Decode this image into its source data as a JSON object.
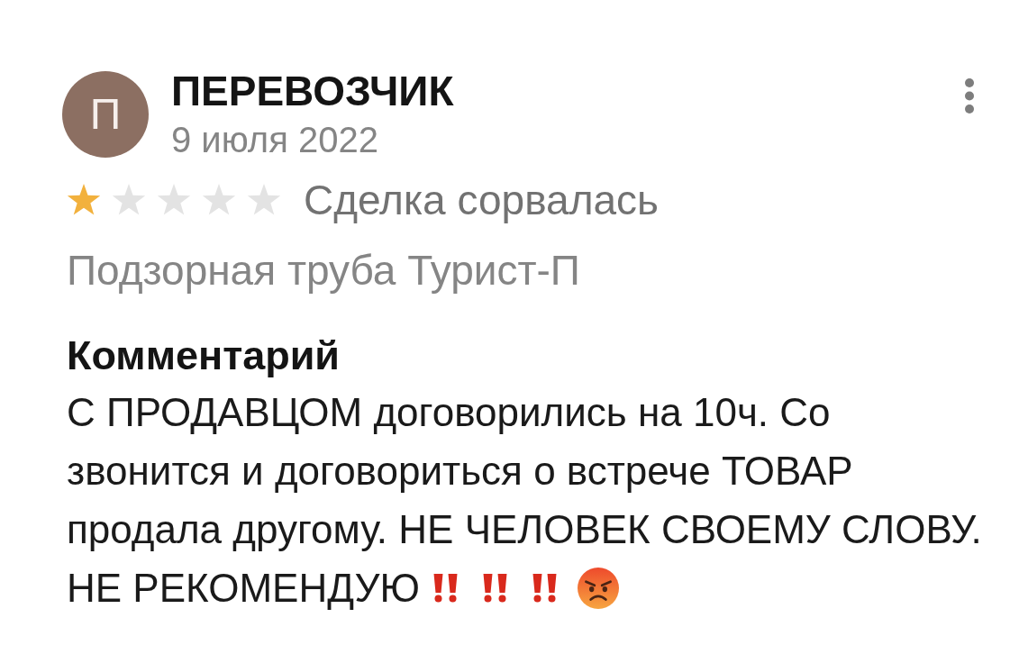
{
  "review": {
    "author": {
      "initial": "П",
      "name": "ПЕРЕВОЗЧИК"
    },
    "date": "9 июля 2022",
    "stars": 1,
    "outcome": "Сделка сорвалась",
    "item": "Подзорная труба Турист-П",
    "comment": {
      "heading": "Комментарий",
      "text": "С ПРОДАВЦОМ договорились на 10ч. Со звонится и договориться о встрече ТОВАР продала другому. НЕ ЧЕЛОВЕК СВОЕМУ СЛОВУ.",
      "closing": "НЕ РЕКОМЕНДУЮ",
      "emoji": [
        {
          "kind": "double-exclamation"
        },
        {
          "kind": "double-exclamation"
        },
        {
          "kind": "double-exclamation"
        },
        {
          "kind": "angry-face"
        }
      ]
    }
  }
}
